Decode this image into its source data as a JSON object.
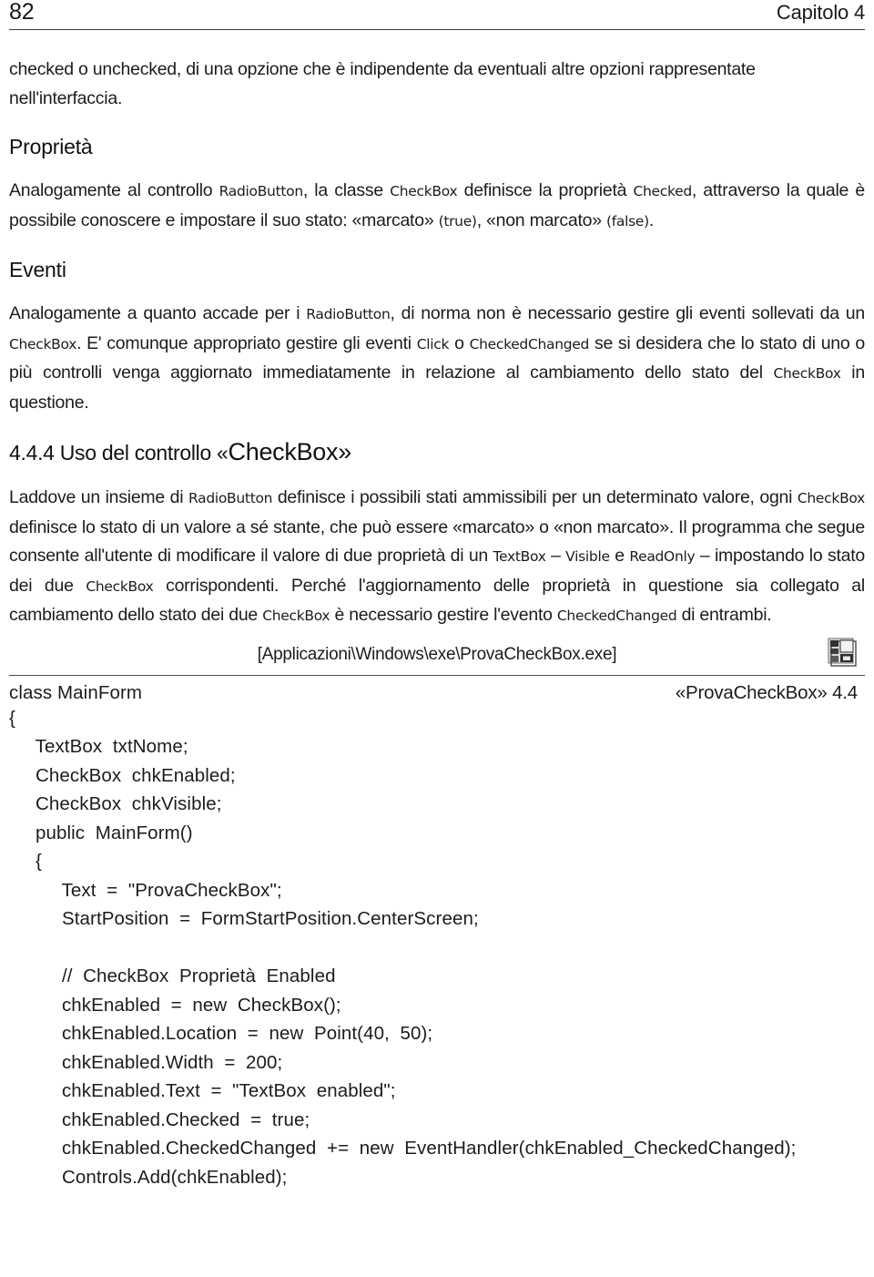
{
  "header": {
    "page_number": "82",
    "chapter": "Capitolo 4"
  },
  "intro_paragraph": "checked o unchecked, di una opzione che è indipendente da eventuali altre opzioni rappresentate nell'interfaccia.",
  "sections": [
    {
      "heading": "Proprietà",
      "paragraph_parts": [
        {
          "text": "Analogamente al controllo ",
          "style": "normal"
        },
        {
          "text": "RadioButton",
          "style": "code"
        },
        {
          "text": ", la classe ",
          "style": "normal"
        },
        {
          "text": "CheckBox",
          "style": "code"
        },
        {
          "text": " definisce la proprietà ",
          "style": "normal"
        },
        {
          "text": "Checked",
          "style": "code"
        },
        {
          "text": ", attraverso la quale è possibile conoscere e impostare il suo stato: «marcato» ",
          "style": "normal"
        },
        {
          "text": "(true)",
          "style": "code"
        },
        {
          "text": ", «non marcato» ",
          "style": "normal"
        },
        {
          "text": "(false)",
          "style": "code"
        },
        {
          "text": ".",
          "style": "normal"
        }
      ]
    },
    {
      "heading": "Eventi",
      "paragraph_parts": [
        {
          "text": "Analogamente a quanto accade per i ",
          "style": "normal"
        },
        {
          "text": "RadioButton",
          "style": "code"
        },
        {
          "text": ", di norma non è necessario gestire gli eventi sollevati da un ",
          "style": "normal"
        },
        {
          "text": "CheckBox",
          "style": "code"
        },
        {
          "text": ". E' comunque appropriato gestire gli eventi ",
          "style": "normal"
        },
        {
          "text": "Click",
          "style": "code"
        },
        {
          "text": " o ",
          "style": "normal"
        },
        {
          "text": "CheckedChanged",
          "style": "code"
        },
        {
          "text": " se si desidera che lo stato di uno o più controlli  venga aggiornato immediatamente in relazione al cambiamento dello stato del ",
          "style": "normal"
        },
        {
          "text": "CheckBox",
          "style": "code"
        },
        {
          "text": "  in questione.",
          "style": "normal"
        }
      ]
    }
  ],
  "numbered_section": {
    "number": "4.4.4",
    "title_before": "Uso del controllo «",
    "title_code": "CheckBox",
    "title_after": "»",
    "paragraph_parts": [
      {
        "text": "Laddove un insieme di ",
        "style": "normal"
      },
      {
        "text": "RadioButton",
        "style": "code"
      },
      {
        "text": " definisce i possibili stati ammissibili per un determinato valore, ogni ",
        "style": "normal"
      },
      {
        "text": "CheckBox",
        "style": "code"
      },
      {
        "text": " definisce lo stato di un valore a sé stante, che può essere «marcato» o «non marcato». Il programma che segue consente all'utente di modificare il valore di due proprietà di un ",
        "style": "normal"
      },
      {
        "text": "TextBox",
        "style": "code"
      },
      {
        "text": " – ",
        "style": "normal"
      },
      {
        "text": "Visible",
        "style": "code"
      },
      {
        "text": " e ",
        "style": "normal"
      },
      {
        "text": "ReadOnly",
        "style": "code"
      },
      {
        "text": " – impostando lo stato dei due ",
        "style": "normal"
      },
      {
        "text": "CheckBox",
        "style": "code"
      },
      {
        "text": " corrispondenti. Perché l'aggiornamento delle proprietà in questione sia collegato al cambiamento dello stato dei due ",
        "style": "normal"
      },
      {
        "text": "CheckBox",
        "style": "code"
      },
      {
        "text": " è necessario gestire l'evento ",
        "style": "normal"
      },
      {
        "text": "CheckedChanged",
        "style": "code"
      },
      {
        "text": " di entrambi.",
        "style": "normal"
      }
    ]
  },
  "exe_caption": {
    "path": "[Applicazioni\\Windows\\exe\\ProvaCheckBox.exe]",
    "icon": "application-window-icon"
  },
  "listing": {
    "title": "class  MainForm",
    "reference": "«ProvaCheckBox»  4.4",
    "lines": [
      "{",
      "     TextBox  txtNome;",
      "     CheckBox  chkEnabled;",
      "     CheckBox  chkVisible;",
      "     public  MainForm()",
      "     {",
      "          Text  =  \"ProvaCheckBox\";",
      "          StartPosition  =  FormStartPosition.CenterScreen;",
      "",
      "          //  CheckBox  Proprietà  Enabled",
      "          chkEnabled  =  new  CheckBox();",
      "          chkEnabled.Location  =  new  Point(40,  50);",
      "          chkEnabled.Width  =  200;",
      "          chkEnabled.Text  =  \"TextBox  enabled\";",
      "          chkEnabled.Checked  =  true;",
      "          chkEnabled.CheckedChanged  +=  new  EventHandler(chkEnabled_CheckedChanged);",
      "          Controls.Add(chkEnabled);"
    ]
  },
  "colors": {
    "text": "#1c1c1c",
    "rule": "#3a3a3a"
  }
}
